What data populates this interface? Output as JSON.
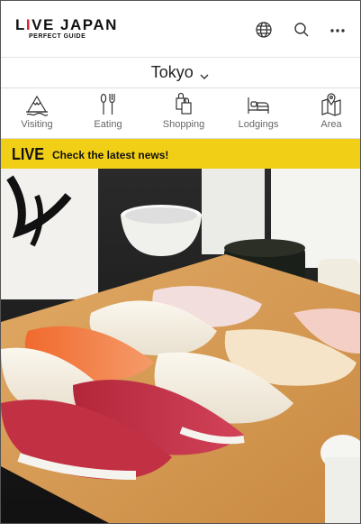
{
  "header": {
    "logo_main_a": "L",
    "logo_main_i": "I",
    "logo_main_rest": "VE JAPAN",
    "logo_sub": "PERFECT GUIDE",
    "icons": [
      "globe-icon",
      "search-icon",
      "more-icon"
    ]
  },
  "city": {
    "label": "Tokyo"
  },
  "categories": [
    {
      "label": "Visiting",
      "icon": "mountain-icon"
    },
    {
      "label": "Eating",
      "icon": "utensils-icon"
    },
    {
      "label": "Shopping",
      "icon": "shopping-bag-icon"
    },
    {
      "label": "Lodgings",
      "icon": "bed-icon"
    },
    {
      "label": "Area",
      "icon": "map-pin-icon"
    }
  ],
  "banner": {
    "live": "LIVE",
    "text": "Check the latest news!",
    "color": "#f2cf17"
  },
  "colors": {
    "brand_red": "#d9262b"
  }
}
